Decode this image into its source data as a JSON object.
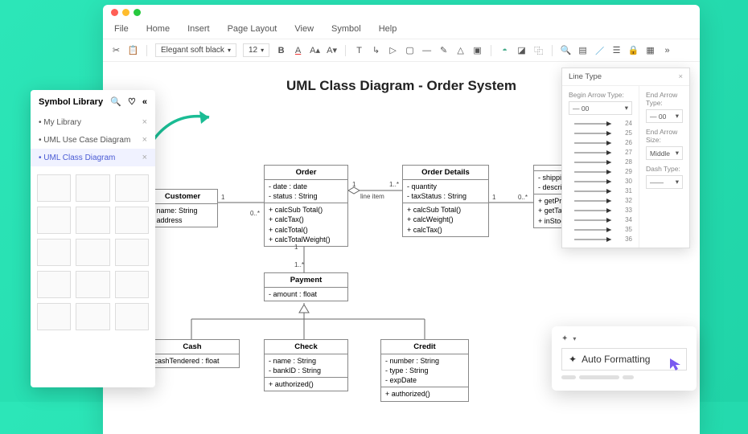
{
  "menubar": [
    "File",
    "Home",
    "Insert",
    "Page Layout",
    "View",
    "Symbol",
    "Help"
  ],
  "toolbar": {
    "font": "Elegant soft black",
    "size": "12"
  },
  "diagram": {
    "title": "UML Class Diagram - Order System"
  },
  "classes": {
    "customer": {
      "name": "Customer",
      "attrs": [
        "- name: String",
        "- address"
      ]
    },
    "order": {
      "name": "Order",
      "attrs": [
        "- date : date",
        "- status : String"
      ],
      "ops": [
        "+ calcSub Total()",
        "+ calcTax()",
        "+ calcTotal()",
        "+ calcTotalWeight()"
      ]
    },
    "details": {
      "name": "Order Details",
      "attrs": [
        "- quantity",
        "- taxStatus : String"
      ],
      "ops": [
        "+ calcSub Total()",
        "+ calcWeight()",
        "+ calcTax()"
      ]
    },
    "item": {
      "name": "",
      "attrs": [
        "- shipping",
        "- descriptio"
      ],
      "ops": [
        "+ getPrice",
        "+ getTax()",
        "+ inStock()"
      ]
    },
    "payment": {
      "name": "Payment",
      "attrs": [
        "- amount : float"
      ]
    },
    "cash": {
      "name": "Cash",
      "attrs": [
        "- cashTendered : float"
      ]
    },
    "check": {
      "name": "Check",
      "attrs": [
        "- name : String",
        "- bankID : String"
      ],
      "ops": [
        "+ authorized()"
      ]
    },
    "credit": {
      "name": "Credit",
      "attrs": [
        "- number : String",
        "- type : String",
        "- expDate"
      ],
      "ops": [
        "+ authorized()"
      ]
    }
  },
  "labels": {
    "one": "1",
    "zeroMany": "0..*",
    "oneMany": "1..*",
    "lineItem": "line item"
  },
  "sidebar": {
    "title": "Symbol Library",
    "rows": [
      {
        "label": "My Library",
        "active": false
      },
      {
        "label": "UML Use Case Diagram",
        "active": false
      },
      {
        "label": "UML Class Diagram",
        "active": true
      }
    ]
  },
  "linePanel": {
    "title": "Line Type",
    "beginLabel": "Begin Arrow Type:",
    "endLabel": "End Arrow Type:",
    "endSizeLabel": "End Arrow Size:",
    "dashLabel": "Dash Type:",
    "sizeVal": "Middle",
    "selVal": "00",
    "arrowNums": [
      24,
      25,
      26,
      27,
      28,
      29,
      30,
      31,
      32,
      33,
      34,
      35,
      36
    ]
  },
  "auto": {
    "label": "Auto Formatting"
  }
}
